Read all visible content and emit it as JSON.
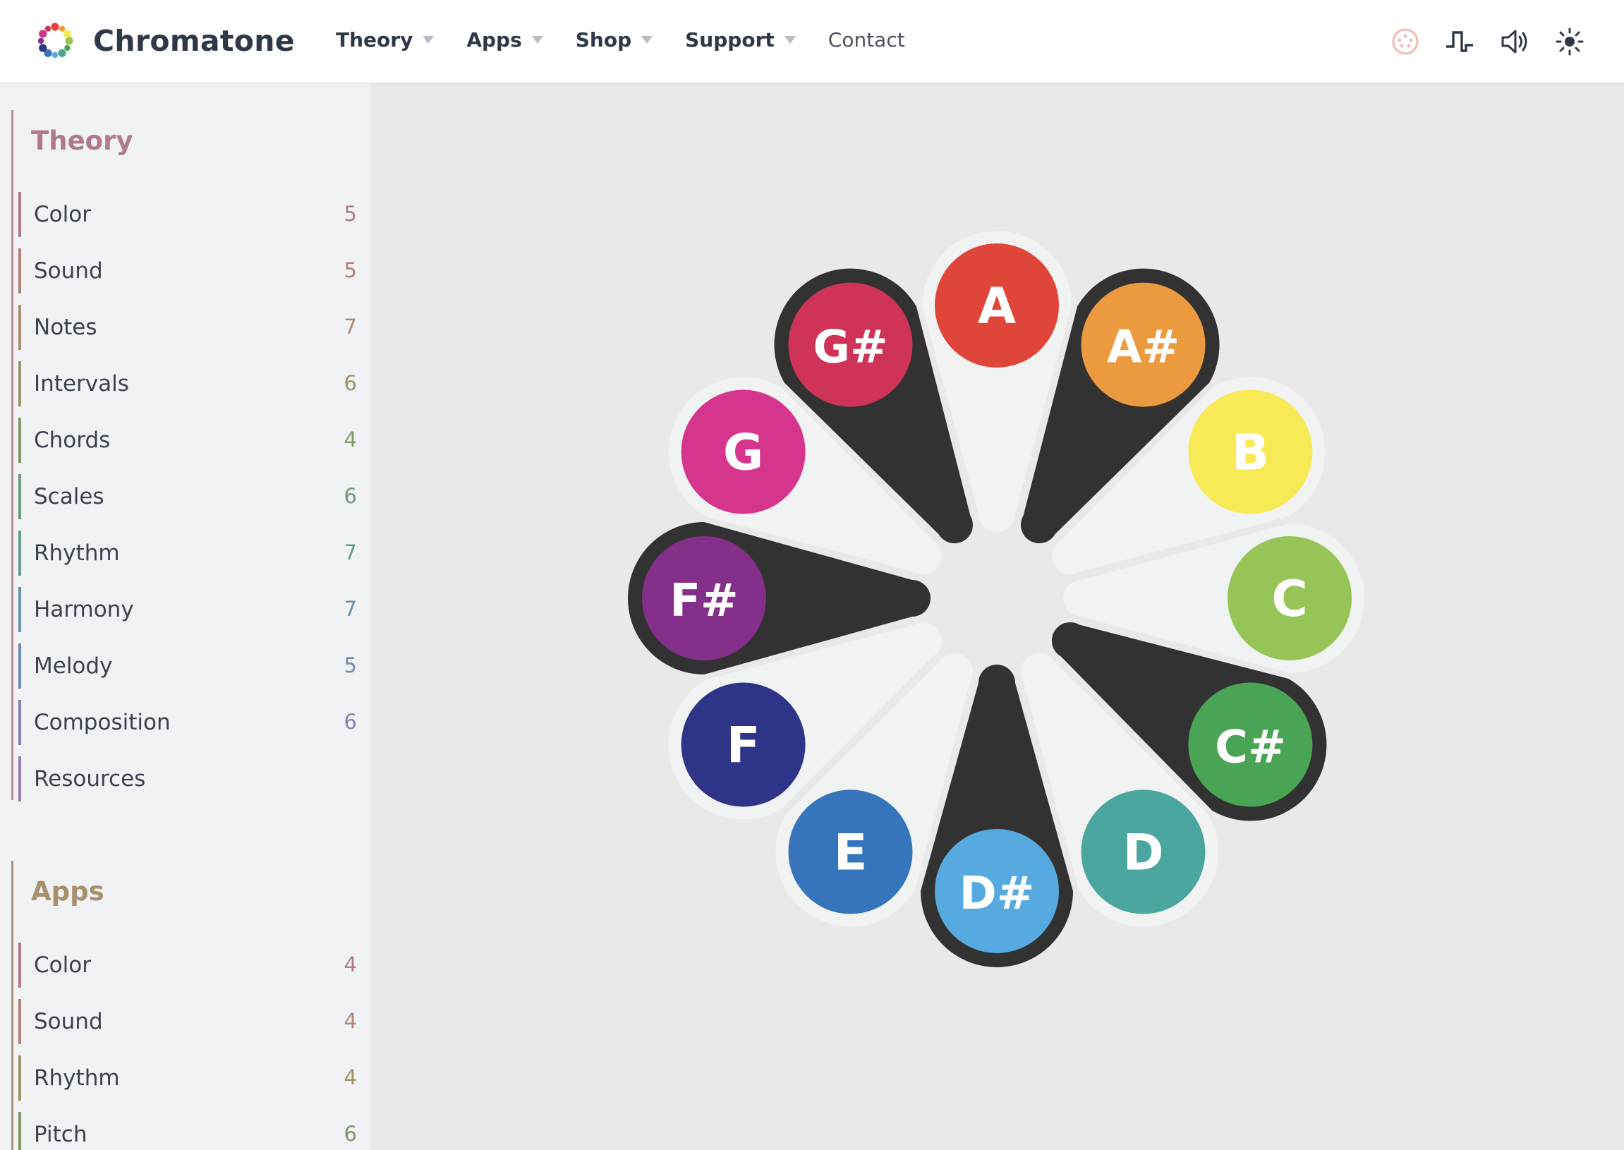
{
  "brand": {
    "name": "Chromatone"
  },
  "nav": {
    "items": [
      {
        "label": "Theory",
        "has_menu": true
      },
      {
        "label": "Apps",
        "has_menu": true
      },
      {
        "label": "Shop",
        "has_menu": true
      },
      {
        "label": "Support",
        "has_menu": true
      },
      {
        "label": "Contact",
        "has_menu": false
      }
    ]
  },
  "toolbar": {
    "icons": [
      "midi-icon",
      "pulse-wave-icon",
      "speaker-icon",
      "sun-icon"
    ]
  },
  "sidebar": {
    "sections": [
      {
        "title": "Theory",
        "color": "#b07a8e",
        "items": [
          {
            "label": "Color",
            "count": "5",
            "color": "#b07a8e"
          },
          {
            "label": "Sound",
            "count": "5",
            "color": "#b08576"
          },
          {
            "label": "Notes",
            "count": "7",
            "color": "#ad8d6e"
          },
          {
            "label": "Intervals",
            "count": "6",
            "color": "#9a9466"
          },
          {
            "label": "Chords",
            "count": "4",
            "color": "#7e9868"
          },
          {
            "label": "Scales",
            "count": "6",
            "color": "#6c9a7c"
          },
          {
            "label": "Rhythm",
            "count": "7",
            "color": "#669a92"
          },
          {
            "label": "Harmony",
            "count": "7",
            "color": "#6894a6"
          },
          {
            "label": "Melody",
            "count": "5",
            "color": "#7089b0"
          },
          {
            "label": "Composition",
            "count": "6",
            "color": "#8282b0"
          },
          {
            "label": "Resources",
            "count": "",
            "color": "#9a7aa8"
          }
        ]
      },
      {
        "title": "Apps",
        "color": "#a88f6e",
        "items": [
          {
            "label": "Color",
            "count": "4",
            "color": "#b07a8e"
          },
          {
            "label": "Sound",
            "count": "4",
            "color": "#b08576"
          },
          {
            "label": "Rhythm",
            "count": "4",
            "color": "#9a9466"
          },
          {
            "label": "Pitch",
            "count": "6",
            "color": "#7e9868"
          }
        ]
      }
    ]
  },
  "wheel": {
    "notes": [
      {
        "label": "A",
        "color": "#e0453a",
        "sharp": false
      },
      {
        "label": "A#",
        "color": "#eb9a40",
        "sharp": true
      },
      {
        "label": "B",
        "color": "#f8ea56",
        "sharp": false
      },
      {
        "label": "C",
        "color": "#97c456",
        "sharp": false
      },
      {
        "label": "C#",
        "color": "#4aa456",
        "sharp": true
      },
      {
        "label": "D",
        "color": "#4aa69e",
        "sharp": false
      },
      {
        "label": "D#",
        "color": "#57aadf",
        "sharp": true
      },
      {
        "label": "E",
        "color": "#3674bc",
        "sharp": false
      },
      {
        "label": "F",
        "color": "#2e3487",
        "sharp": false
      },
      {
        "label": "F#",
        "color": "#84308b",
        "sharp": true
      },
      {
        "label": "G",
        "color": "#d6358d",
        "sharp": false
      },
      {
        "label": "G#",
        "color": "#cf3458",
        "sharp": true
      }
    ],
    "active_notes": [
      "G#",
      "A#",
      "C#",
      "D#",
      "F#"
    ]
  }
}
